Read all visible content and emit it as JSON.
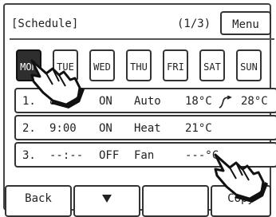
{
  "header": {
    "title": "[Schedule]",
    "page": "(1/3)",
    "menu_label": "Menu"
  },
  "days": [
    "MON",
    "TUE",
    "WED",
    "THU",
    "FRI",
    "SAT",
    "SUN"
  ],
  "selected_day": "MON",
  "rows": [
    {
      "index": "1.",
      "time": "8:00",
      "power": "ON",
      "mode": "Auto",
      "temp": "18°C",
      "temp2": "28°C",
      "arrow_icon": "temperature-range-arrow-icon"
    },
    {
      "index": "2.",
      "time": "9:00",
      "power": "ON",
      "mode": "Heat",
      "temp": "21°C"
    },
    {
      "index": "3.",
      "time": "--:--",
      "power": "OFF",
      "mode": "Fan",
      "temp": "---°C"
    }
  ],
  "footer": {
    "back_label": "Back",
    "down_icon": "triangle-down-icon",
    "copy_label": "Copy"
  },
  "icons": {
    "pointer": "pointing-hand-icon"
  },
  "colors": {
    "selected_day_bg": "#2e2e2e",
    "border": "#333333"
  }
}
